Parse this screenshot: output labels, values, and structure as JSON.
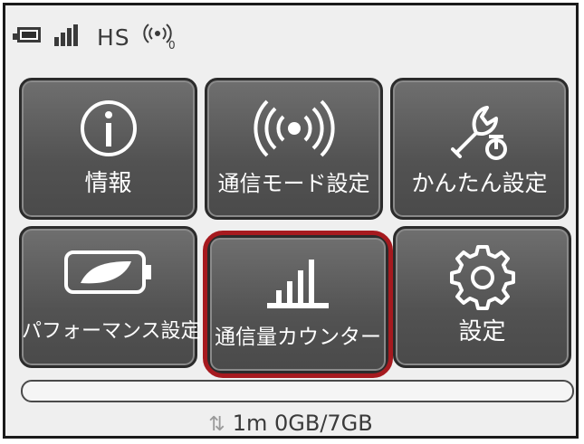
{
  "status_bar": {
    "battery_icon": "battery-icon",
    "signal_icon": "signal-bars-icon",
    "network_type": "HS",
    "wifi_icon": "wifi-broadcast-icon",
    "wifi_count": "0"
  },
  "menu": {
    "info": "情報",
    "comm_mode": "通信モード設定",
    "easy_setup": "かんたん設定",
    "performance": "パフォーマンス設定",
    "data_counter": "通信量カウンター",
    "settings": "設定"
  },
  "usage": {
    "arrow_icon": "up-down-arrows-icon",
    "text": "1m 0GB/7GB",
    "progress_fraction": 0
  },
  "colors": {
    "tile": "#5a5a5a",
    "highlight": "#a61a1f",
    "frame": "#1a1a1a"
  }
}
